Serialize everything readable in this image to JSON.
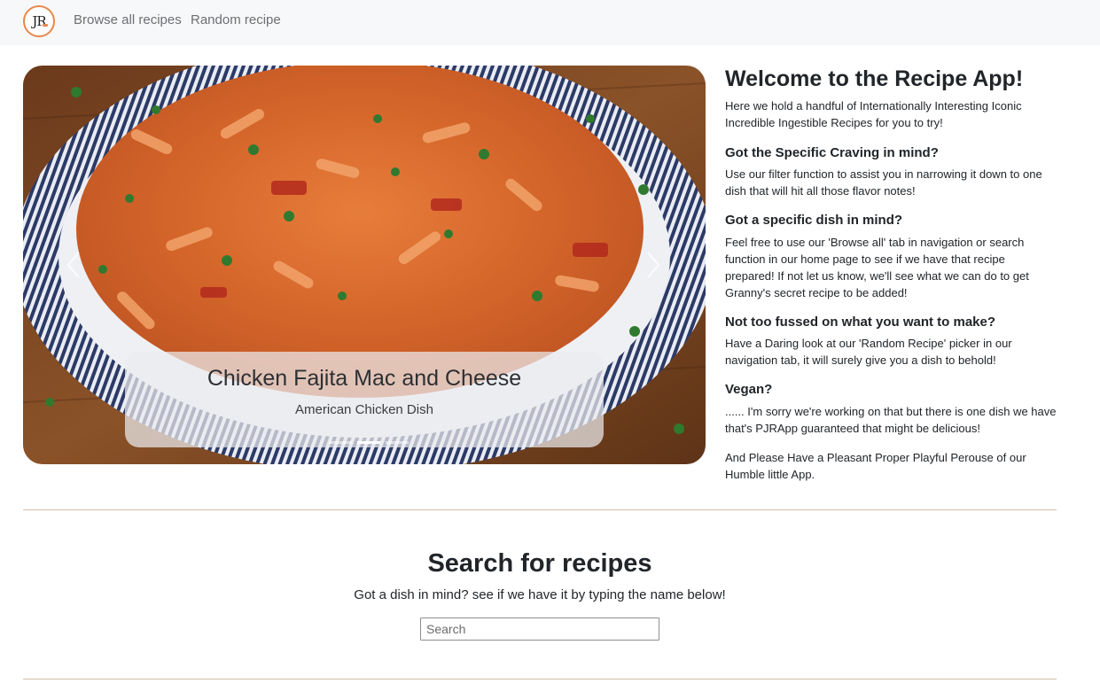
{
  "navbar": {
    "logo_text": "JR",
    "links": [
      {
        "label": "Browse all recipes"
      },
      {
        "label": "Random recipe"
      }
    ]
  },
  "carousel": {
    "slide": {
      "title": "Chicken Fajita Mac and Cheese",
      "subtitle": "American Chicken Dish"
    },
    "indicators": [
      false,
      true,
      false
    ],
    "prev_icon": "chevron-left-icon",
    "next_icon": "chevron-right-icon"
  },
  "welcome": {
    "title": "Welcome to the Recipe App!",
    "intro": "Here we hold a handful of Internationally Interesting Iconic Incredible Ingestible Recipes for you to try!",
    "sections": [
      {
        "heading": "Got the Specific Craving in mind?",
        "body": "Use our filter function to assist you in narrowing it down to one dish that will hit all those flavor notes!"
      },
      {
        "heading": "Got a specific dish in mind?",
        "body": "Feel free to use our 'Browse all' tab in navigation or search function in our home page to see if we have that recipe prepared! If not let us know, we'll see what we can do to get Granny's secret recipe to be added!"
      },
      {
        "heading": "Not too fussed on what you want to make?",
        "body": "Have a Daring look at our 'Random Recipe' picker in our navigation tab, it will surely give you a dish to behold!"
      },
      {
        "heading": "Vegan?",
        "body": "...... I'm sorry we're working on that but there is one dish we have that's PJRApp guaranteed that might be delicious!"
      }
    ],
    "closing": "And Please Have a Pleasant Proper Playful Perouse of our Humble little App."
  },
  "search": {
    "title": "Search for recipes",
    "subtitle": "Got a dish in mind? see if we have it by typing the name below!",
    "placeholder": "Search",
    "value": ""
  },
  "colors": {
    "navbar_bg": "#f7f8f9",
    "logo_accent": "#e8874a",
    "divider": "#d4bfa6"
  }
}
